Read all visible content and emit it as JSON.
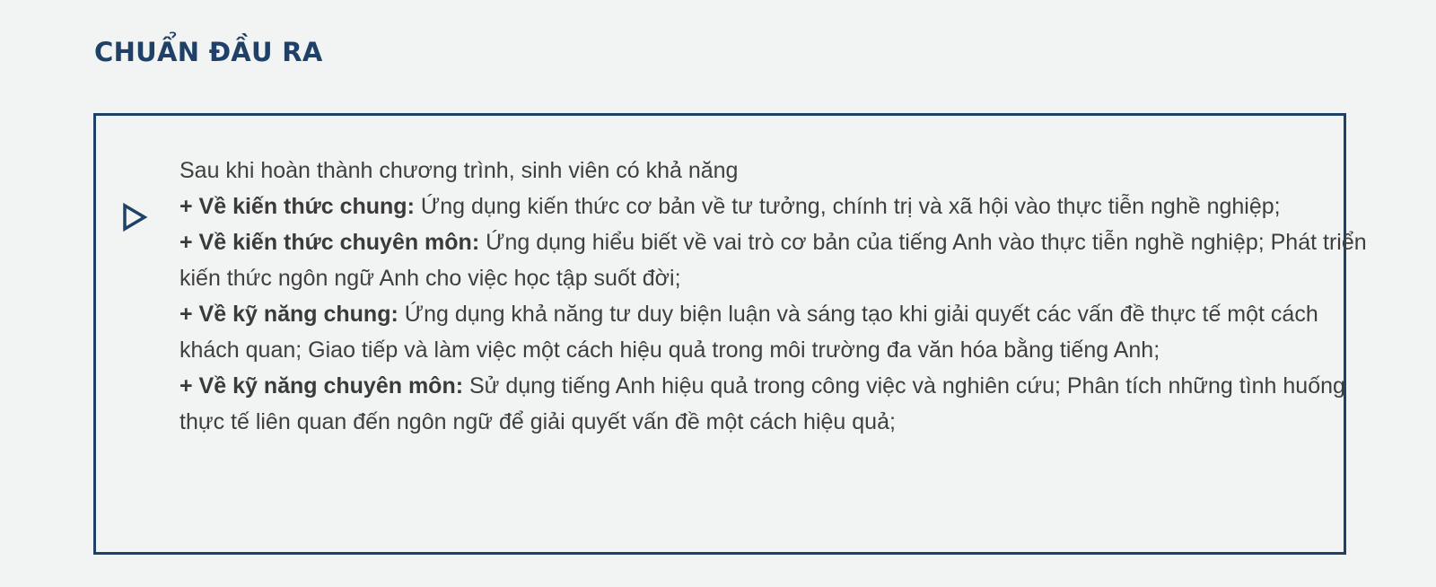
{
  "title": "CHUẨN ĐẦU RA",
  "icon": "play-triangle-icon",
  "colors": {
    "accent": "#1f4167",
    "text": "#3f3f3f",
    "background": "#f2f3f3"
  },
  "intro": "Sau khi hoàn thành chương trình, sinh viên có khả năng",
  "items": [
    {
      "label": "+ Về kiến thức chung:",
      "text": " Ứng dụng kiến thức cơ bản về tư tưởng, chính trị và xã hội vào thực tiễn nghề nghiệp;"
    },
    {
      "label": "+ Về kiến thức chuyên môn:",
      "text": " Ứng dụng hiểu biết về vai trò cơ bản của tiếng Anh vào thực tiễn nghề nghiệp; Phát triển kiến thức ngôn ngữ Anh cho việc học tập suốt đời;"
    },
    {
      "label": "+ Về kỹ năng chung:",
      "text": " Ứng dụng khả năng tư duy biện luận và sáng tạo khi giải quyết các vấn đề thực tế một cách khách quan; Giao tiếp và làm việc một cách hiệu quả trong môi trường đa văn hóa bằng tiếng Anh;"
    },
    {
      "label": "+ Về kỹ năng chuyên môn:",
      "text": " Sử dụng tiếng Anh hiệu quả trong công việc và nghiên cứu; Phân tích những tình huống thực tế liên quan đến ngôn ngữ để giải quyết vấn đề một cách hiệu quả;"
    }
  ]
}
